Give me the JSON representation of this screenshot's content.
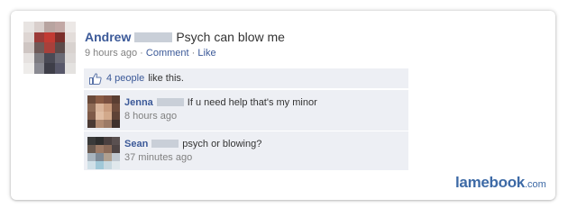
{
  "post": {
    "author": "Andrew",
    "text": "Psych can blow me",
    "time": "9 hours ago",
    "separator": "·",
    "comment_link": "Comment",
    "like_link": "Like"
  },
  "likes": {
    "count_text": "4 people",
    "suffix": "like this."
  },
  "comments": [
    {
      "author": "Jenna",
      "text": "If u need help that's my minor",
      "time": "8 hours ago"
    },
    {
      "author": "Sean",
      "text": "psych or blowing?",
      "time": "37 minutes ago"
    }
  ],
  "watermark": {
    "brand": "lamebook",
    "tld": ".com"
  },
  "colors": {
    "link_blue": "#3b5998",
    "meta_gray": "#808080",
    "comment_bg": "#edeff4",
    "watermark_blue": "#3d6aa6"
  },
  "icons": {
    "like": "thumbs-up-icon"
  }
}
